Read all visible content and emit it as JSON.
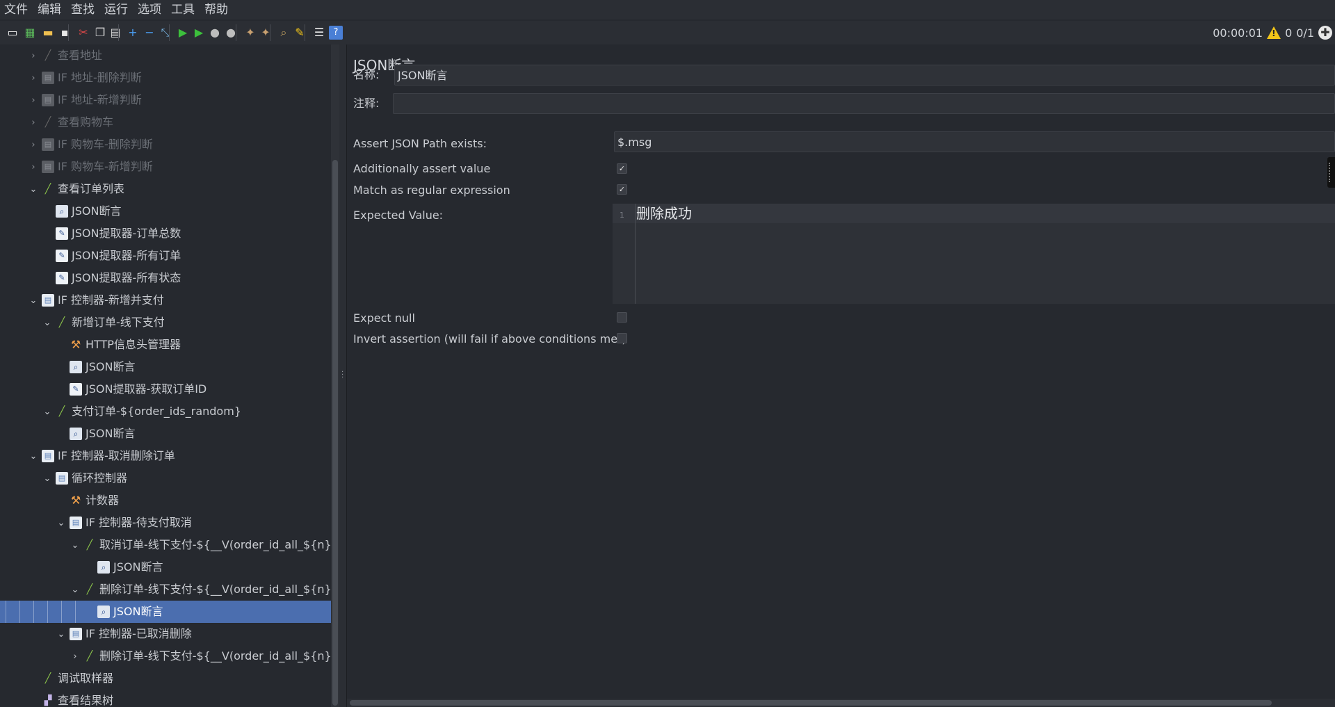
{
  "menu": [
    "文件",
    "编辑",
    "查找",
    "运行",
    "选项",
    "工具",
    "帮助"
  ],
  "toolbar": {
    "icons": [
      "new-icon",
      "templates-icon",
      "open-icon",
      "save-icon",
      "cut-icon",
      "copy-icon",
      "paste-icon",
      "expand-icon",
      "collapse-icon",
      "toggle-icon",
      "start-icon",
      "start-no-pause-icon",
      "stop-icon",
      "shutdown-icon",
      "clear-icon",
      "clear-all-icon",
      "search-icon",
      "reset-search-icon",
      "function-helper-icon",
      "help-icon"
    ],
    "timer": "00:00:01",
    "warnings": "0",
    "threads": "0/1"
  },
  "tree": [
    {
      "label": "查看地址",
      "icon": "sampler",
      "disabled": true,
      "toggle": "expand"
    },
    {
      "label": "IF 地址-删除判断",
      "icon": "controller",
      "disabled": true,
      "toggle": "expand"
    },
    {
      "label": "IF 地址-新增判断",
      "icon": "controller",
      "disabled": true,
      "toggle": "expand"
    },
    {
      "label": "查看购物车",
      "icon": "sampler",
      "disabled": true,
      "toggle": "expand"
    },
    {
      "label": "IF 购物车-删除判断",
      "icon": "controller",
      "disabled": true,
      "toggle": "expand"
    },
    {
      "label": "IF 购物车-新增判断",
      "icon": "controller",
      "disabled": true,
      "toggle": "expand"
    },
    {
      "label": "查看订单列表",
      "icon": "sampler",
      "disabled": false,
      "toggle": "collapse"
    },
    {
      "label": "JSON断言",
      "icon": "assertion",
      "disabled": false,
      "toggle": ""
    },
    {
      "label": "JSON提取器-订单总数",
      "icon": "extractor",
      "disabled": false,
      "toggle": ""
    },
    {
      "label": "JSON提取器-所有订单",
      "icon": "extractor",
      "disabled": false,
      "toggle": ""
    },
    {
      "label": "JSON提取器-所有状态",
      "icon": "extractor",
      "disabled": false,
      "toggle": ""
    },
    {
      "label": "IF 控制器-新增并支付",
      "icon": "controller",
      "disabled": false,
      "toggle": "collapse"
    },
    {
      "label": "新增订单-线下支付",
      "icon": "sampler",
      "disabled": false,
      "toggle": "collapse"
    },
    {
      "label": "HTTP信息头管理器",
      "icon": "tool",
      "disabled": false,
      "toggle": ""
    },
    {
      "label": "JSON断言",
      "icon": "assertion",
      "disabled": false,
      "toggle": ""
    },
    {
      "label": "JSON提取器-获取订单ID",
      "icon": "extractor",
      "disabled": false,
      "toggle": ""
    },
    {
      "label": "支付订单-${order_ids_random}",
      "icon": "sampler",
      "disabled": false,
      "toggle": "collapse"
    },
    {
      "label": "JSON断言",
      "icon": "assertion",
      "disabled": false,
      "toggle": ""
    },
    {
      "label": "IF 控制器-取消删除订单",
      "icon": "controller",
      "disabled": false,
      "toggle": "collapse"
    },
    {
      "label": "循环控制器",
      "icon": "controller",
      "disabled": false,
      "toggle": "collapse"
    },
    {
      "label": "计数器",
      "icon": "tool",
      "disabled": false,
      "toggle": ""
    },
    {
      "label": "IF 控制器-待支付取消",
      "icon": "controller",
      "disabled": false,
      "toggle": "collapse"
    },
    {
      "label": "取消订单-线下支付-${__V(order_id_all_${n})}",
      "icon": "sampler",
      "disabled": false,
      "toggle": "collapse"
    },
    {
      "label": "JSON断言",
      "icon": "assertion",
      "disabled": false,
      "toggle": ""
    },
    {
      "label": "删除订单-线下支付-${__V(order_id_all_${n})}",
      "icon": "sampler",
      "disabled": false,
      "toggle": "collapse"
    },
    {
      "label": "JSON断言",
      "icon": "assertion",
      "disabled": false,
      "toggle": "",
      "selected": true
    },
    {
      "label": "IF 控制器-已取消删除",
      "icon": "controller",
      "disabled": false,
      "toggle": "collapse"
    },
    {
      "label": "删除订单-线下支付-${__V(order_id_all_${n})}",
      "icon": "sampler",
      "disabled": false,
      "toggle": "expand"
    },
    {
      "label": "调试取样器",
      "icon": "sampler",
      "disabled": false,
      "toggle": ""
    },
    {
      "label": "查看结果树",
      "icon": "visualizer",
      "disabled": false,
      "toggle": ""
    }
  ],
  "panel": {
    "title": "JSON断言",
    "name_label": "名称:",
    "name_value": "JSON断言",
    "comment_label": "注释:",
    "comment_value": "",
    "path_label": "Assert JSON Path exists:",
    "path_value": "$.msg",
    "assert_value_label": "Additionally assert value",
    "assert_value_checked": true,
    "regex_label": "Match as regular expression",
    "regex_checked": true,
    "expected_label": "Expected Value:",
    "expected_line_no": "1",
    "expected_value": "删除成功",
    "expect_null_label": "Expect null",
    "expect_null_checked": false,
    "invert_label": "Invert assertion (will fail if above conditions met)",
    "invert_checked": false
  },
  "colors": {
    "background": "#26292f",
    "selection": "#4b6eaf",
    "text": "#c9ccd1",
    "disabled_text": "#6b6f76"
  }
}
